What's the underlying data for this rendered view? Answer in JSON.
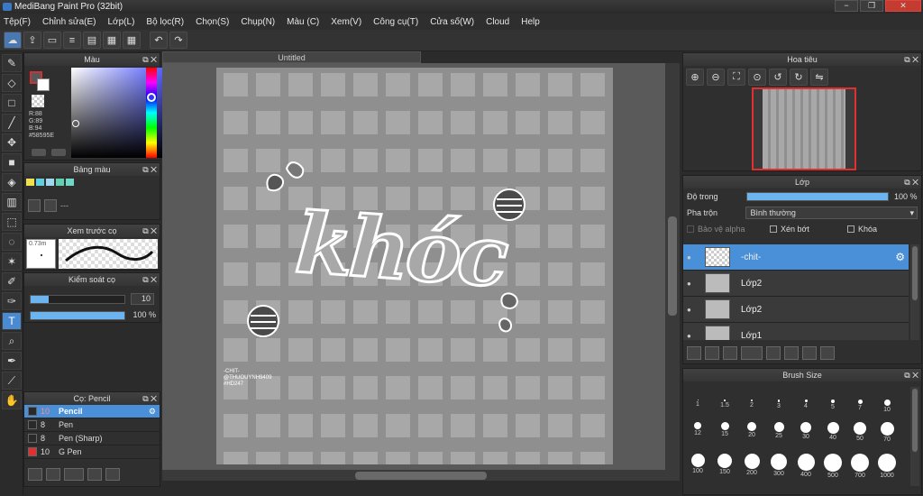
{
  "window": {
    "title": "MediBang Paint Pro (32bit)",
    "minimize": "−",
    "maximize": "❐",
    "close": "✕"
  },
  "menu": [
    "Tệp(F)",
    "Chỉnh sửa(E)",
    "Lớp(L)",
    "Bộ lọc(R)",
    "Chọn(S)",
    "Chụp(N)",
    "Màu (C)",
    "Xem(V)",
    "Công cụ(T)",
    "Cửa số(W)",
    "Cloud",
    "Help"
  ],
  "document": {
    "tab": "Untitled"
  },
  "artwork": {
    "main_text": "khóc",
    "credit_lines": [
      "-CHIT-",
      "@THUOUYNH9409",
      "#HD247"
    ]
  },
  "color_panel": {
    "title": "Màu",
    "r": "R:88",
    "g": "G:89",
    "b": "B:94",
    "hex": "#58595E"
  },
  "palette_panel": {
    "title": "Bảng màu",
    "more": "---"
  },
  "brush_preview": {
    "title": "Xem trước cọ",
    "size": "0.73m"
  },
  "brush_control": {
    "title": "Kiểm soát cọ",
    "size_value": "10",
    "opacity_value": "100 %"
  },
  "brush_list": {
    "title": "Cọ: Pencil",
    "items": [
      {
        "size": "10",
        "name": "Pencil",
        "color": "#2a2a2a"
      },
      {
        "size": "8",
        "name": "Pen",
        "color": "#2a2a2a"
      },
      {
        "size": "8",
        "name": "Pen (Sharp)",
        "color": "#2a2a2a"
      },
      {
        "size": "10",
        "name": "G Pen",
        "color": "#e03030"
      }
    ]
  },
  "navigator": {
    "title": "Hoa tiêu"
  },
  "layers_panel": {
    "title": "Lớp",
    "opacity_label": "Độ trong",
    "opacity_value": "100 %",
    "blend_label": "Pha trộn",
    "blend_value": "Bình thường",
    "protect_alpha": "Bảo vệ alpha",
    "clip": "Xén bớt",
    "lock": "Khóa",
    "layers": [
      {
        "name": "-chit-",
        "selected": true
      },
      {
        "name": "Lớp2",
        "selected": false
      },
      {
        "name": "Lớp2",
        "selected": false
      },
      {
        "name": "Lớp1",
        "selected": false
      }
    ]
  },
  "brush_size": {
    "title": "Brush Size",
    "sizes": [
      "1",
      "1.5",
      "2",
      "3",
      "4",
      "5",
      "7",
      "10",
      "12",
      "15",
      "20",
      "25",
      "30",
      "40",
      "50",
      "70",
      "100",
      "150",
      "200",
      "300",
      "400",
      "500",
      "700",
      "1000"
    ]
  },
  "colors": {
    "accent": "#4a90d8",
    "background": "#2b2b2b",
    "panel": "#2f2f2f"
  }
}
